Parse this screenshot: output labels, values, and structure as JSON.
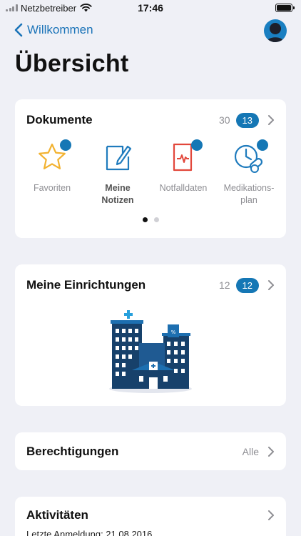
{
  "status_bar": {
    "carrier": "Netzbetreiber",
    "time": "17:46"
  },
  "nav": {
    "back_label": "Willkommen"
  },
  "page": {
    "title": "Übersicht"
  },
  "documents": {
    "title": "Dokumente",
    "count": "30",
    "badge": "13",
    "items": [
      {
        "label": "Favoriten",
        "icon": "star-icon"
      },
      {
        "label": "Meine Notizen",
        "icon": "note-pencil-icon"
      },
      {
        "label": "Notfalldaten",
        "icon": "emergency-document-icon"
      },
      {
        "label": "Medikations-plan",
        "icon": "medication-clock-icon"
      }
    ],
    "pager": {
      "pages": 2,
      "current": 1
    }
  },
  "facilities": {
    "title": "Meine Einrichtungen",
    "count": "12",
    "badge": "12",
    "illustration": "hospital-buildings-illustration"
  },
  "permissions": {
    "title": "Berechtigungen",
    "value": "Alle"
  },
  "activities": {
    "title": "Aktivitäten",
    "last_login": "Letzte Anmeldung: 21.08.2016"
  },
  "colors": {
    "accent": "#1577b5",
    "link": "#1a73b8",
    "background": "#eff0f6",
    "star": "#f2b230",
    "emergency": "#e2473b"
  }
}
